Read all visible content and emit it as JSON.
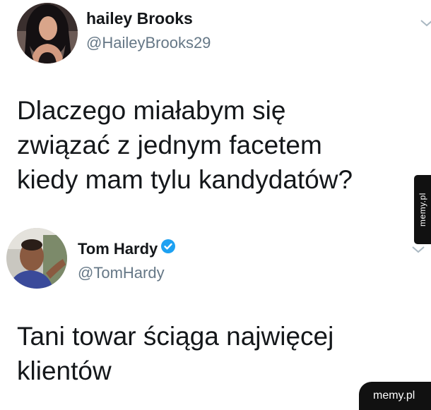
{
  "tweet1": {
    "author_name": "hailey Brooks",
    "author_handle": "@HaileyBrooks29",
    "text_lines": [
      "Dlaczego miałabym się",
      "związać z jednym facetem",
      "kiedy mam tylu kandydatów?"
    ],
    "avatar_icon": "woman-portrait-avatar",
    "menu_icon": "chevron-down-icon"
  },
  "tweet2": {
    "author_name": "Tom Hardy",
    "author_handle": "@TomHardy",
    "verified": true,
    "verified_color": "#1da1f2",
    "text_lines": [
      "Tani towar ściąga najwięcej",
      "klientów"
    ],
    "avatar_icon": "man-portrait-avatar",
    "menu_icon": "chevron-down-icon"
  },
  "watermarks": {
    "side": "memy.pl",
    "corner": "memy.pl"
  },
  "colors": {
    "text": "#14171a",
    "secondary": "#657786",
    "watermark_bg": "#111111"
  }
}
